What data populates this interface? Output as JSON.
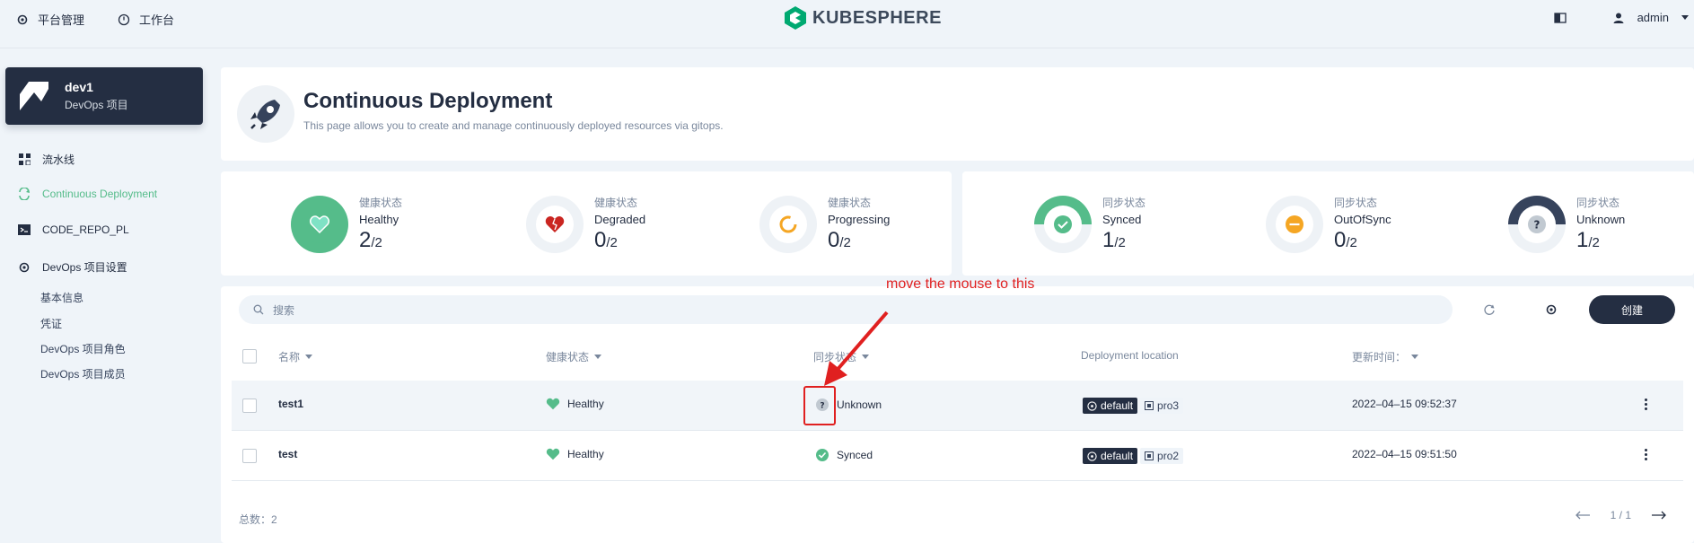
{
  "topbar": {
    "nav_platform": "平台管理",
    "nav_workbench": "工作台",
    "logo_text": "KUBESPHERE",
    "user": "admin"
  },
  "project": {
    "name": "dev1",
    "type": "DevOps 项目"
  },
  "sidebar": {
    "items": [
      {
        "label": "流水线"
      },
      {
        "label": "Continuous Deployment"
      },
      {
        "label": "CODE_REPO_PL"
      },
      {
        "label": "DevOps 项目设置"
      }
    ],
    "sub_items": [
      {
        "label": "基本信息"
      },
      {
        "label": "凭证"
      },
      {
        "label": "DevOps 项目角色"
      },
      {
        "label": "DevOps 项目成员"
      }
    ]
  },
  "header": {
    "title": "Continuous Deployment",
    "description": "This page allows you to create and manage continuously deployed resources via gitops."
  },
  "health_stats": [
    {
      "label": "健康状态",
      "status": "Healthy",
      "count": "2",
      "total": "/2",
      "ratio": 1.0,
      "color": "#55bc8a"
    },
    {
      "label": "健康状态",
      "status": "Degraded",
      "count": "0",
      "total": "/2",
      "ratio": 0,
      "color": "#ca2621"
    },
    {
      "label": "健康状态",
      "status": "Progressing",
      "count": "0",
      "total": "/2",
      "ratio": 0,
      "color": "#f5a623"
    }
  ],
  "sync_stats": [
    {
      "label": "同步状态",
      "status": "Synced",
      "count": "1",
      "total": "/2",
      "ratio": 0.5,
      "color": "#55bc8a"
    },
    {
      "label": "同步状态",
      "status": "OutOfSync",
      "count": "0",
      "total": "/2",
      "ratio": 0,
      "color": "#f5a623"
    },
    {
      "label": "同步状态",
      "status": "Unknown",
      "count": "1",
      "total": "/2",
      "ratio": 0.5,
      "color": "#36435c"
    }
  ],
  "toolbar": {
    "search_placeholder": "搜索",
    "create_label": "创建"
  },
  "table": {
    "columns": {
      "name": "名称",
      "health": "健康状态",
      "sync": "同步状态",
      "location": "Deployment location",
      "updated": "更新时间："
    },
    "rows": [
      {
        "name": "test1",
        "health": "Healthy",
        "sync": "Unknown",
        "cluster": "default",
        "namespace": "pro3",
        "updated": "2022–04–15 09:52:37"
      },
      {
        "name": "test",
        "health": "Healthy",
        "sync": "Synced",
        "cluster": "default",
        "namespace": "pro2",
        "updated": "2022–04–15 09:51:50"
      }
    ]
  },
  "footer": {
    "total": "总数：2",
    "page": "1 / 1"
  },
  "annotation": {
    "text": "move the mouse to this"
  }
}
